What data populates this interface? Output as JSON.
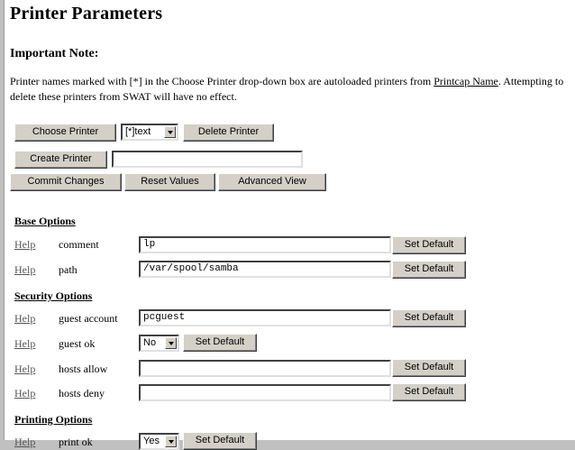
{
  "page": {
    "title": "Printer Parameters",
    "note_heading": "Important Note:",
    "note_text_before": "Printer names marked with [*] in the Choose Printer drop-down box are autoloaded printers from ",
    "note_link": "Printcap Name",
    "note_text_after": ". Attempting to delete these printers from SWAT will have no effect."
  },
  "toolbar": {
    "choose_printer": "Choose Printer",
    "printer_select_value": "[*]text",
    "delete_printer": "Delete Printer",
    "create_printer": "Create Printer",
    "create_printer_value": "",
    "commit_changes": "Commit Changes",
    "reset_values": "Reset Values",
    "advanced_view": "Advanced View"
  },
  "sections": {
    "base": "Base Options",
    "security": "Security Options",
    "printing": "Printing Options"
  },
  "params": {
    "help_label": "Help",
    "set_default": "Set Default",
    "comment": {
      "label": "comment",
      "value": "lp"
    },
    "path": {
      "label": "path",
      "value": "/var/spool/samba"
    },
    "guest_account": {
      "label": "guest account",
      "value": "pcguest"
    },
    "guest_ok": {
      "label": "guest ok",
      "value": "No"
    },
    "hosts_allow": {
      "label": "hosts allow",
      "value": ""
    },
    "hosts_deny": {
      "label": "hosts deny",
      "value": ""
    },
    "print_ok": {
      "label": "print ok",
      "value": "Yes"
    }
  }
}
